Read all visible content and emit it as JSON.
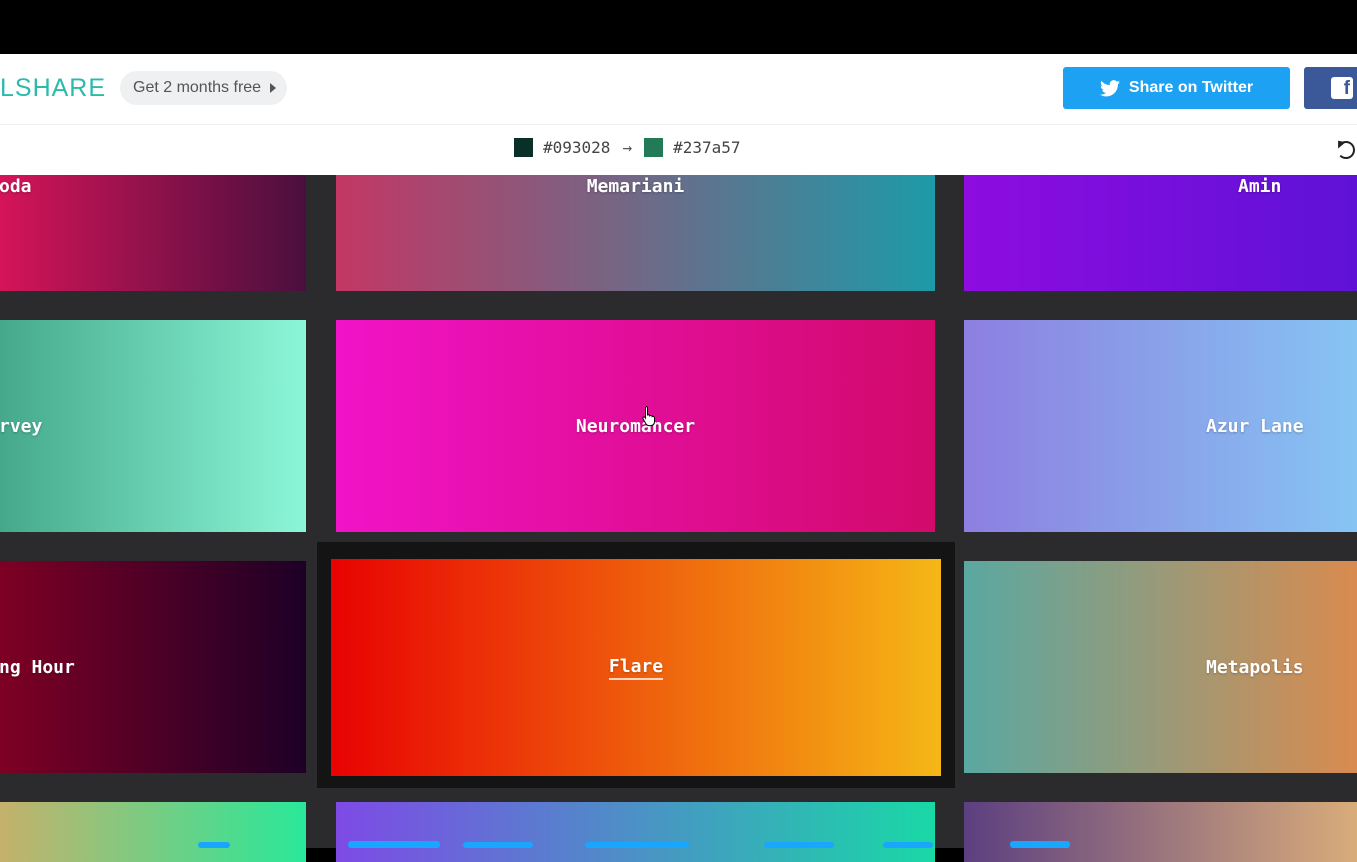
{
  "header": {
    "brand": "LSHARE",
    "promo": "Get 2 months free",
    "twitter_button": "Share on Twitter"
  },
  "color_bar": {
    "from_hex": "#093028",
    "to_hex": "#237a57",
    "arrow": "→"
  },
  "gradients": [
    {
      "name": "oda",
      "colors": [
        "#d41458",
        "#4a0f3e"
      ]
    },
    {
      "name": "Memariani",
      "colors": [
        "#c33764",
        "#1d9aa8"
      ]
    },
    {
      "name": "Amin",
      "colors": [
        "#8e0ce0",
        "#5e12d6"
      ]
    },
    {
      "name": "rvey",
      "colors": [
        "#45a88a",
        "#8cf7d8"
      ]
    },
    {
      "name": "Neuromancer",
      "colors": [
        "#f113c7",
        "#d20a6b"
      ]
    },
    {
      "name": "Azur Lane",
      "colors": [
        "#8d7fe0",
        "#86c4f3"
      ]
    },
    {
      "name": "ng Hour",
      "colors": [
        "#7e0024",
        "#1d0027"
      ]
    },
    {
      "name": "Flare",
      "colors": [
        "#e80202",
        "#f5b716"
      ]
    },
    {
      "name": "Metapolis",
      "colors": [
        "#5aa8a1",
        "#d98b4f"
      ]
    },
    {
      "name": "",
      "colors": [
        "#c5b16b",
        "#29e89a"
      ]
    },
    {
      "name": "",
      "colors": [
        "#7e4ae6",
        "#19d8a6"
      ]
    },
    {
      "name": "",
      "colors": [
        "#5c3f80",
        "#d9ac7a"
      ]
    }
  ]
}
